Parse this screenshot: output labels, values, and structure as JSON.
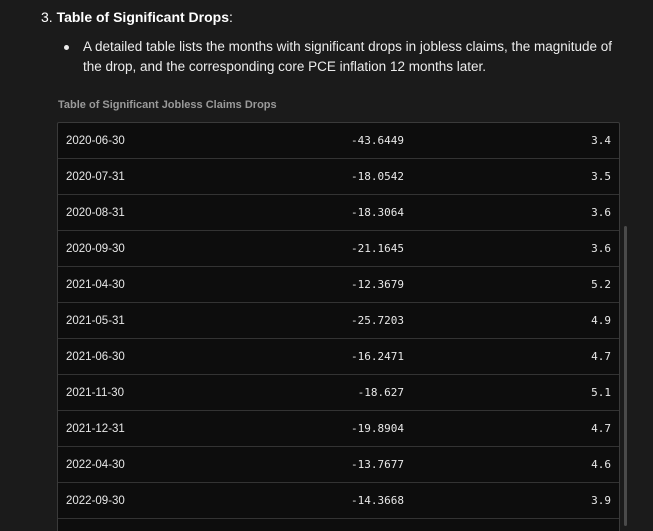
{
  "section": {
    "number": "3.",
    "title": "Table of Significant Drops",
    "colon": ":"
  },
  "bullet": {
    "text": "A detailed table lists the months with significant drops in jobless claims, the magnitude of the drop, and the corresponding core PCE inflation 12 months later."
  },
  "table": {
    "title": "Table of Significant Jobless Claims Drops",
    "rows": [
      {
        "date": "2020-06-30",
        "drop": "-43.6449",
        "pce": "3.4"
      },
      {
        "date": "2020-07-31",
        "drop": "-18.0542",
        "pce": "3.5"
      },
      {
        "date": "2020-08-31",
        "drop": "-18.3064",
        "pce": "3.6"
      },
      {
        "date": "2020-09-30",
        "drop": "-21.1645",
        "pce": "3.6"
      },
      {
        "date": "2021-04-30",
        "drop": "-12.3679",
        "pce": "5.2"
      },
      {
        "date": "2021-05-31",
        "drop": "-25.7203",
        "pce": "4.9"
      },
      {
        "date": "2021-06-30",
        "drop": "-16.2471",
        "pce": "4.7"
      },
      {
        "date": "2021-11-30",
        "drop": "-18.627",
        "pce": "5.1"
      },
      {
        "date": "2021-12-31",
        "drop": "-19.8904",
        "pce": "4.7"
      },
      {
        "date": "2022-04-30",
        "drop": "-13.7677",
        "pce": "4.6"
      },
      {
        "date": "2022-09-30",
        "drop": "-14.3668",
        "pce": "3.9"
      }
    ]
  },
  "colors": {
    "background": "#1b1b1b",
    "table_background": "#0d0d0d",
    "border": "#333333"
  }
}
